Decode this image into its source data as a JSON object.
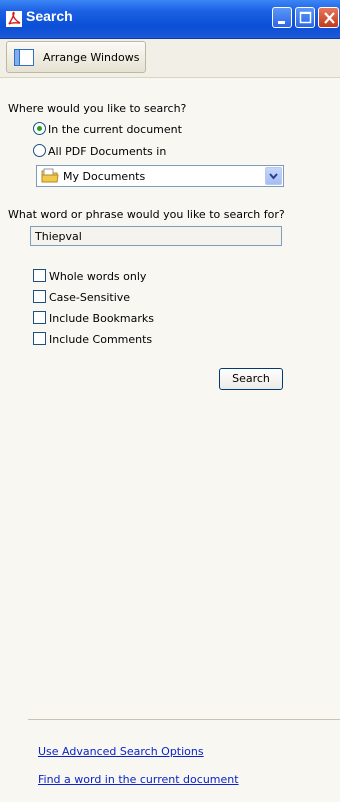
{
  "window": {
    "title": "Search",
    "controls": [
      "minimize",
      "maximize",
      "close"
    ]
  },
  "toolbar": {
    "arrange_label": "Arrange Windows"
  },
  "search_location": {
    "prompt": "Where would you like to search?",
    "options": [
      {
        "label": "In the current document",
        "selected": true
      },
      {
        "label": "All PDF Documents in",
        "selected": false
      }
    ],
    "folder": "My Documents"
  },
  "search_query": {
    "prompt": "What word or phrase would you like to search for?",
    "value": "Thiepval"
  },
  "options": [
    {
      "label": "Whole words only",
      "checked": false
    },
    {
      "label": "Case-Sensitive",
      "checked": false
    },
    {
      "label": "Include Bookmarks",
      "checked": false
    },
    {
      "label": "Include Comments",
      "checked": false
    }
  ],
  "search_button": "Search",
  "links": {
    "advanced": "Use Advanced Search Options",
    "find_word": "Find a word in the current document"
  },
  "colors": {
    "titlebar": "#0a4fd5",
    "link": "#0b24c9",
    "radio_dot": "#21a121"
  }
}
